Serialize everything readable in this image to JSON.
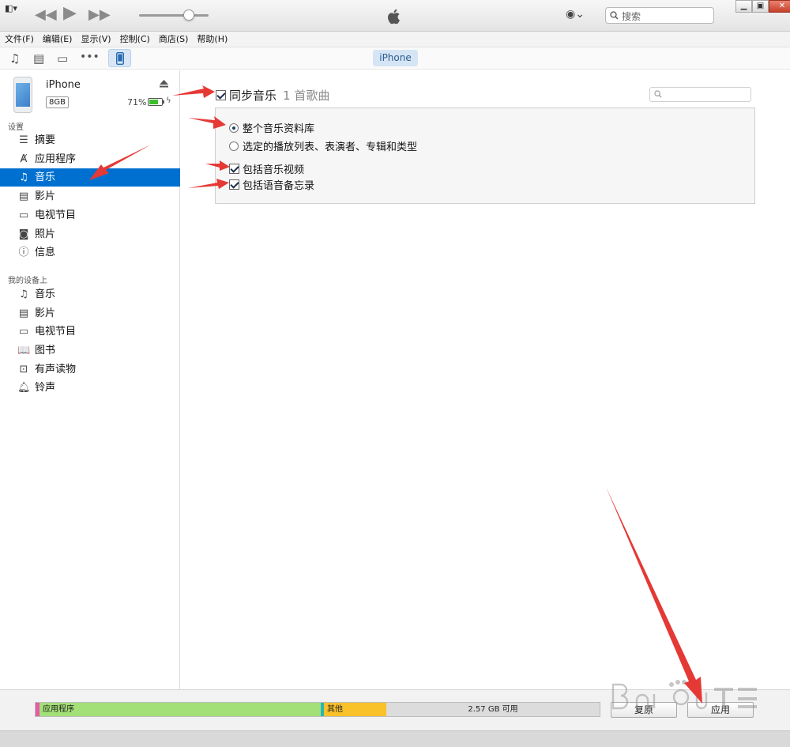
{
  "menu": [
    "文件(F)",
    "编辑(E)",
    "显示(V)",
    "控制(C)",
    "商店(S)",
    "帮助(H)"
  ],
  "search": {
    "placeholder": "搜索"
  },
  "device_tab": "iPhone",
  "device": {
    "name": "iPhone",
    "capacity": "8GB",
    "battery_percent": "71%",
    "battery_level": 0.71
  },
  "sidebar": {
    "settings_header": "设置",
    "settings_items": [
      {
        "label": "摘要",
        "icon": "summary-icon"
      },
      {
        "label": "应用程序",
        "icon": "app-store-icon"
      },
      {
        "label": "音乐",
        "icon": "music-note-icon",
        "active": true
      },
      {
        "label": "影片",
        "icon": "film-icon"
      },
      {
        "label": "电视节目",
        "icon": "tv-icon"
      },
      {
        "label": "照片",
        "icon": "camera-icon"
      },
      {
        "label": "信息",
        "icon": "info-icon"
      }
    ],
    "ondevice_header": "我的设备上",
    "ondevice_items": [
      {
        "label": "音乐",
        "icon": "music-note-icon"
      },
      {
        "label": "影片",
        "icon": "film-icon"
      },
      {
        "label": "电视节目",
        "icon": "tv-icon"
      },
      {
        "label": "图书",
        "icon": "book-icon"
      },
      {
        "label": "有声读物",
        "icon": "audiobook-icon"
      },
      {
        "label": "铃声",
        "icon": "bell-icon"
      }
    ]
  },
  "main": {
    "sync_label": "同步音乐",
    "sync_count": "1 首歌曲",
    "sync_checked": true,
    "radio_entire": "整个音乐资料库",
    "radio_selected": "选定的播放列表、表演者、专辑和类型",
    "include_videos": "包括音乐视频",
    "include_voice": "包括语音备忘录"
  },
  "capacity": {
    "apps_label": "应用程序",
    "other_label": "其他",
    "free_label": "2.57 GB 可用"
  },
  "buttons": {
    "revert": "复原",
    "apply": "应用"
  },
  "colors": {
    "accent": "#0070d0",
    "apps": "#a3e077",
    "other": "#f9c22a",
    "audio": "#e75aa7",
    "arrow": "#e53935"
  }
}
